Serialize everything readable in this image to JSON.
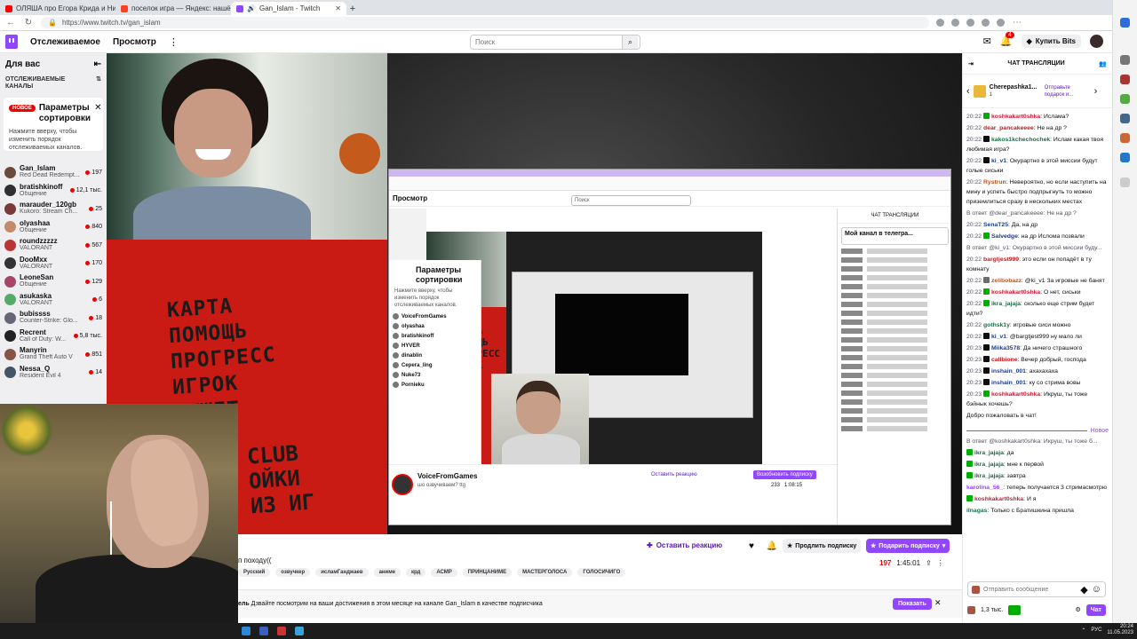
{
  "browser": {
    "tabs": [
      {
        "label": "ОЛЯША про Егора Крида и Нив...",
        "color": "#ff0000",
        "active": false
      },
      {
        "label": "поселок игра — Яндекс: нашё...",
        "color": "#fc3f1d",
        "active": false
      },
      {
        "label": "Gan_Islam - Twitch",
        "color": "#9147ff",
        "active": true
      }
    ],
    "url": "https://www.twitch.tv/gan_islam"
  },
  "nav": {
    "following": "Отслеживаемое",
    "browse": "Просмотр",
    "search_placeholder": "Поиск",
    "notif_count": "4",
    "bits": "Купить Bits"
  },
  "sidebar": {
    "title": "Для вас",
    "followed_title": "ОТСЛЕЖИВАЕМЫЕ КАНАЛЫ",
    "sort_badge": "НОВОЕ",
    "sort_title": "Параметры сортировки",
    "sort_desc": "Нажмите вверху, чтобы изменить порядок отслеживаемых каналов.",
    "channels": [
      {
        "name": "Gan_Islam",
        "game": "Red Dead Redempt...",
        "viewers": "197",
        "color": "#6b4a3a"
      },
      {
        "name": "bratishkinoff",
        "game": "Общение",
        "viewers": "12,1 тыс.",
        "color": "#2f2f2f"
      },
      {
        "name": "marauder_120gb",
        "game": "Kukoro: Stream Ch...",
        "viewers": "25",
        "color": "#7a3a3a"
      },
      {
        "name": "olyashaa",
        "game": "Общение",
        "viewers": "840",
        "color": "#c58a6a"
      },
      {
        "name": "roundzzzzz",
        "game": "VALORANT",
        "viewers": "567",
        "color": "#b33"
      },
      {
        "name": "DooMxx",
        "game": "VALORANT",
        "viewers": "170",
        "color": "#333"
      },
      {
        "name": "LeoneSan",
        "game": "Общение",
        "viewers": "129",
        "color": "#a46"
      },
      {
        "name": "asukaska",
        "game": "VALORANT",
        "viewers": "6",
        "color": "#5a6"
      },
      {
        "name": "bubissss",
        "game": "Counter-Strike: Glo...",
        "viewers": "18",
        "color": "#667"
      },
      {
        "name": "Recrent",
        "game": "Call of Duty: W...",
        "viewers": "5,8 тыс.",
        "color": "#222"
      },
      {
        "name": "Manyrin",
        "game": "Grand Theft Auto V",
        "viewers": "851",
        "color": "#854"
      },
      {
        "name": "Nessa_Q",
        "game": "Resident Evil 4",
        "viewers": "14",
        "color": "#456"
      }
    ]
  },
  "stream": {
    "red_text": "КАРТА\nПОМОЩЬ\nПРОГРЕСС\nИГРОК\nВЫЖЕТ",
    "red_text2": "CLUB\nОЙКИ\nИЗ ИГ",
    "nested": {
      "nav": "Просмотр",
      "search": "Поиск",
      "overlay_title": "Параметры сортировки",
      "overlay_desc": "Нажмите вверху, чтобы изменить порядок отслеживаемых каналов.",
      "overlay_channels": [
        "VoiceFromGames",
        "olyashaa",
        "bratishkinoff",
        "HYVER",
        "dinablin",
        "Cepeгa_ling",
        "Nuke73",
        "Pornieku"
      ],
      "chat_header": "ЧАТ ТРАНСЛЯЦИИ",
      "pinned": "Мой канал в телегра...",
      "channel": "VoiceFromGames",
      "sub": "шо озвучиваем? ttg",
      "react": "Оставить реакцию",
      "sub_btn": "Возобновить подписку",
      "stats": "233   1:08:15",
      "red": "КАРТА\nПОМОЩЬ\nПРОГРЕСС\nИГРОК"
    }
  },
  "info": {
    "react": "Оставить реакцию",
    "extend": "Продлить подписку",
    "gift": "Подарить подписку",
    "title": "п походу((",
    "viewers": "197",
    "uptime": "1:45:01",
    "tags": [
      "Русский",
      "озвучкер",
      "исламГанджаев",
      "аниме",
      "крд",
      "АСМР",
      "ПРИНЦАНИМЕ",
      "МАСТЕРГОЛОСА",
      "ГОЛОСИЧИГО"
    ],
    "banner_label": "ель",
    "banner": "Дзвайте посмотрим на ваши достижения в этом месяце на канале Gan_Islam в качестве подписчика",
    "show": "Показать"
  },
  "chat": {
    "title": "ЧАТ ТРАНСЛЯЦИИ",
    "pinned_name": "Cherepashka1...",
    "pinned_count": "1",
    "pinned_gift": "Отправьте подарок и...",
    "messages": [
      {
        "ts": "20:22",
        "name": "koshkakart0shka",
        "color": "#c41e3a",
        "badge": "#00ad03",
        "text": "Ислама?"
      },
      {
        "ts": "20:22",
        "name": "dear_pancakeeee",
        "color": "#b22222",
        "badge": "",
        "text": "Не на др ?"
      },
      {
        "ts": "20:22",
        "name": "kakos1kchechochek",
        "color": "#1e6b4a",
        "badge": "#0e0e10",
        "text": "Ислам какая твоя любимая игра?"
      },
      {
        "ts": "20:22",
        "name": "ki_v1",
        "color": "#1e3c8a",
        "badge": "#0e0e10",
        "text": "Окурартно в этой миссии будут голые сиськи"
      },
      {
        "ts": "20:22",
        "name": "Rystrun",
        "color": "#b8541c",
        "badge": "",
        "text": "Невероятно, но если наступить на мину и успеть быстро подпрыгнуть то можно приземлиться сразу в нескольких местах"
      },
      {
        "ts": "",
        "name": "",
        "color": "",
        "badge": "",
        "text": "",
        "reply": "В ответ @dear_pancakeeee: Не на др ?"
      },
      {
        "ts": "20:22",
        "name": "SenaT25",
        "color": "#1e3c8a",
        "badge": "",
        "text": "Да, на др"
      },
      {
        "ts": "20:22",
        "name": "Salvedge",
        "color": "#1e3c8a",
        "badge": "#00ad03",
        "text": "на др Ислома позвали"
      },
      {
        "ts": "",
        "name": "",
        "color": "",
        "badge": "",
        "text": "",
        "reply": "В ответ @ki_v1: Окурартно в этой миссии буду..."
      },
      {
        "ts": "20:22",
        "name": "bargtjest999",
        "color": "#b22222",
        "badge": "",
        "text": "это если он попадёт в ту комнату"
      },
      {
        "ts": "20:22",
        "name": "zelibobazz",
        "color": "#b8541c",
        "badge": "#6b6b6b",
        "text": "@ki_v1 За игровые не банят"
      },
      {
        "ts": "20:22",
        "name": "koshkakart0shka",
        "color": "#c41e3a",
        "badge": "#00ad03",
        "text": "О нет, сиськи"
      },
      {
        "ts": "20:22",
        "name": "ikra_jajaja",
        "color": "#1e6b4a",
        "badge": "#00ad03",
        "text": "сколько еще стрим будет идти?"
      },
      {
        "ts": "20:22",
        "name": "gothsk1y",
        "color": "#1e6b4a",
        "badge": "",
        "text": "игровые сиси можно"
      },
      {
        "ts": "20:22",
        "name": "ki_v1",
        "color": "#1e3c8a",
        "badge": "#0e0e10",
        "text": "@bargtjest999 ну мало ли"
      },
      {
        "ts": "20:23",
        "name": "Miika3578",
        "color": "#1e3c8a",
        "badge": "#0e0e10",
        "text": "Да ничего страшного"
      },
      {
        "ts": "20:23",
        "name": "callbione",
        "color": "#b22222",
        "badge": "#0e0e10",
        "text": "Вечер добрый, господа"
      },
      {
        "ts": "20:23",
        "name": "inshain_001",
        "color": "#1e3c8a",
        "badge": "#0e0e10",
        "text": "ахахахаха"
      },
      {
        "ts": "20:23",
        "name": "inshain_001",
        "color": "#1e3c8a",
        "badge": "#0e0e10",
        "text": "ку со стрима вовы"
      },
      {
        "ts": "20:23",
        "name": "koshkakart0shka",
        "color": "#c41e3a",
        "badge": "#00ad03",
        "text": "Икруш, ты тоже бэйнык хочешь?"
      }
    ],
    "welcome": "Добро пожаловать в чат!",
    "new_label": "Новое",
    "after": [
      {
        "name": "",
        "color": "",
        "badge": "",
        "text": "",
        "reply": "В ответ @koshkakart0shka: Икруш, ты тоже б..."
      },
      {
        "name": "ikra_jajaja",
        "color": "#1e6b4a",
        "badge": "#00ad03",
        "text": "да"
      },
      {
        "name": "ikra_jajaja",
        "color": "#1e6b4a",
        "badge": "#00ad03",
        "text": "мне к первой"
      },
      {
        "name": "ikra_jajaja",
        "color": "#1e6b4a",
        "badge": "#00ad03",
        "text": "завтра"
      },
      {
        "name": "karolina_56_",
        "color": "#9147ff",
        "badge": "",
        "text": "теперь получается 3 стримасмотрю"
      },
      {
        "name": "koshkakart0shka",
        "color": "#c41e3a",
        "badge": "#00ad03",
        "text": "И я"
      },
      {
        "name": "ilnagas",
        "color": "#1e6b4a",
        "badge": "",
        "text": "Только с Братишкина пришла"
      }
    ],
    "input_placeholder": "Отправить сообщение",
    "points": "1,3 тыс.",
    "chat_btn": "Чат"
  },
  "taskbar": {
    "lang": "РУС",
    "time": "20:24",
    "date": "11.05.2023"
  }
}
